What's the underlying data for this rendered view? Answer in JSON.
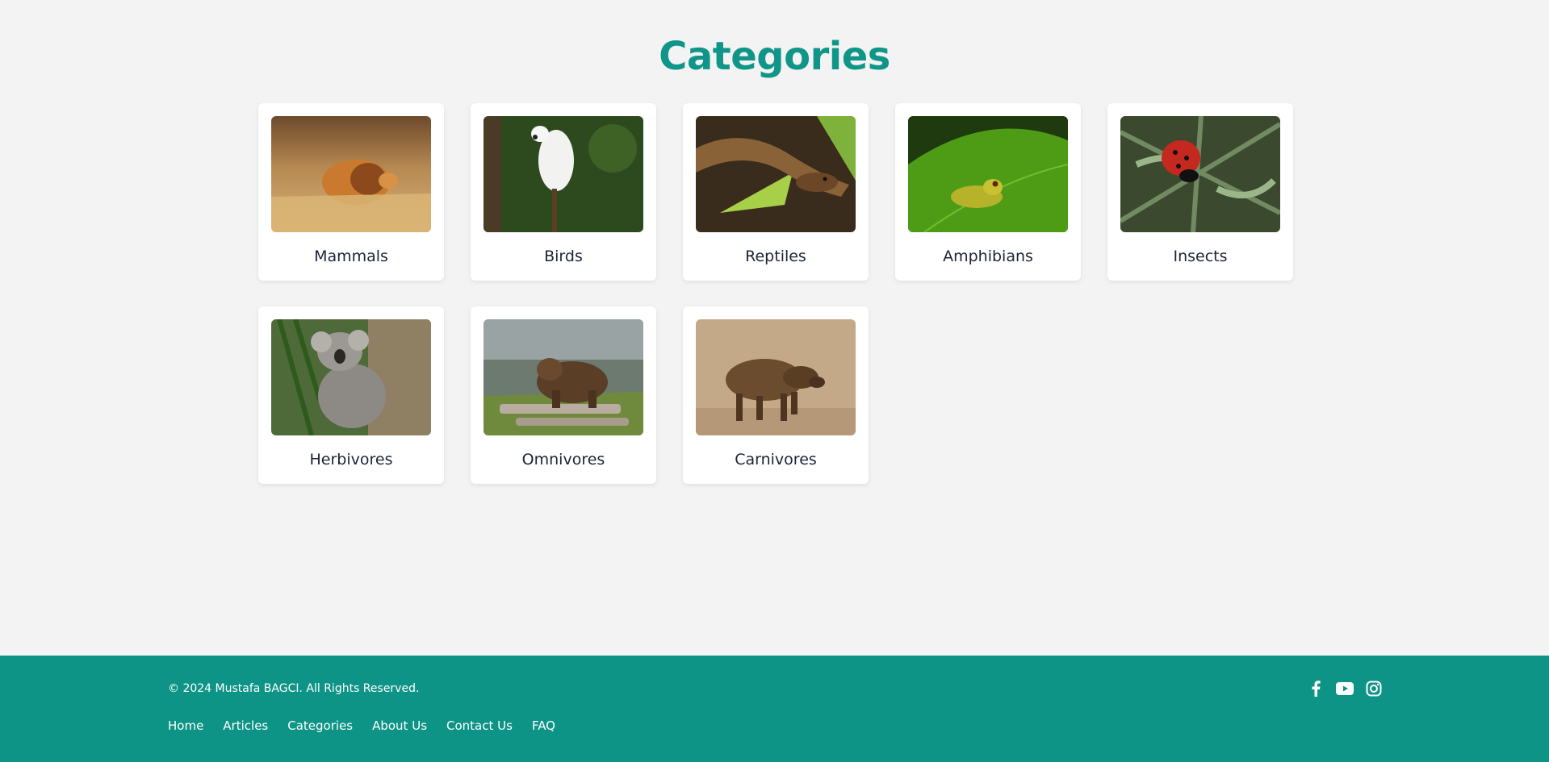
{
  "page": {
    "title": "Categories"
  },
  "categories": [
    {
      "label": "Mammals",
      "image": "lion-photo"
    },
    {
      "label": "Birds",
      "image": "cockatoo-photo"
    },
    {
      "label": "Reptiles",
      "image": "snake-photo"
    },
    {
      "label": "Amphibians",
      "image": "frog-photo"
    },
    {
      "label": "Insects",
      "image": "ladybug-photo"
    },
    {
      "label": "Herbivores",
      "image": "koala-photo"
    },
    {
      "label": "Omnivores",
      "image": "bear-photo"
    },
    {
      "label": "Carnivores",
      "image": "hyena-photo"
    }
  ],
  "footer": {
    "copyright": "© 2024 Mustafa BAGCI. All Rights Reserved.",
    "links": [
      "Home",
      "Articles",
      "Categories",
      "About Us",
      "Contact Us",
      "FAQ"
    ],
    "socials": [
      "facebook-icon",
      "youtube-icon",
      "instagram-icon"
    ]
  },
  "colors": {
    "accent": "#109688",
    "footer_bg": "#0e9486",
    "background": "#f3f3f3"
  }
}
